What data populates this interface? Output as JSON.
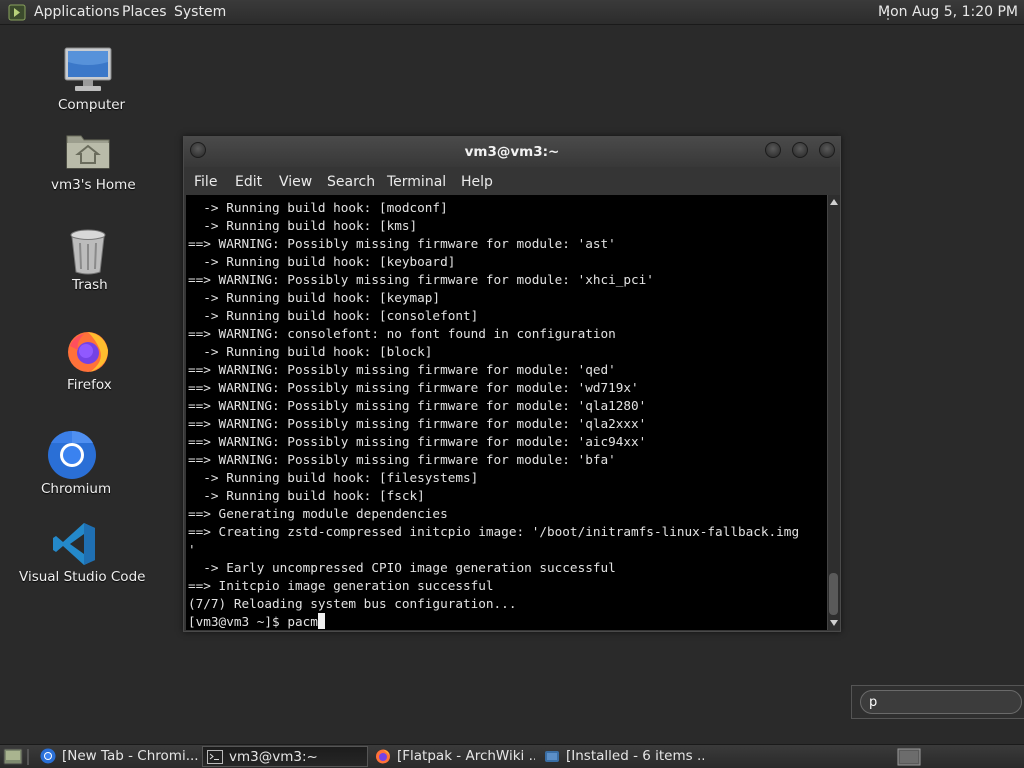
{
  "top_panel": {
    "menus": [
      "Applications",
      "Places",
      "System"
    ],
    "clock": "Mon Aug  5,  1:20 PM"
  },
  "desktop": {
    "icons": [
      {
        "label": "Computer",
        "icon": "computer-icon"
      },
      {
        "label": "vm3's Home",
        "icon": "home-folder-icon"
      },
      {
        "label": "Trash",
        "icon": "trash-icon"
      },
      {
        "label": "Firefox",
        "icon": "firefox-icon"
      },
      {
        "label": "Chromium",
        "icon": "chromium-icon"
      },
      {
        "label": "Visual Studio Code",
        "icon": "vscode-icon"
      }
    ]
  },
  "terminal": {
    "title": "vm3@vm3:~",
    "menu": [
      "File",
      "Edit",
      "View",
      "Search",
      "Terminal",
      "Help"
    ],
    "lines": [
      "  -> Running build hook: [modconf]",
      "  -> Running build hook: [kms]",
      "==> WARNING: Possibly missing firmware for module: 'ast'",
      "  -> Running build hook: [keyboard]",
      "==> WARNING: Possibly missing firmware for module: 'xhci_pci'",
      "  -> Running build hook: [keymap]",
      "  -> Running build hook: [consolefont]",
      "==> WARNING: consolefont: no font found in configuration",
      "  -> Running build hook: [block]",
      "==> WARNING: Possibly missing firmware for module: 'qed'",
      "==> WARNING: Possibly missing firmware for module: 'wd719x'",
      "==> WARNING: Possibly missing firmware for module: 'qla1280'",
      "==> WARNING: Possibly missing firmware for module: 'qla2xxx'",
      "==> WARNING: Possibly missing firmware for module: 'aic94xx'",
      "==> WARNING: Possibly missing firmware for module: 'bfa'",
      "  -> Running build hook: [filesystems]",
      "  -> Running build hook: [fsck]",
      "==> Generating module dependencies",
      "==> Creating zstd-compressed initcpio image: '/boot/initramfs-linux-fallback.img",
      "'",
      "  -> Early uncompressed CPIO image generation successful",
      "==> Initcpio image generation successful",
      "(7/7) Reloading system bus configuration..."
    ],
    "prompt": "[vm3@vm3 ~]$ ",
    "command": "pacm"
  },
  "search": {
    "value": "p"
  },
  "taskbar": {
    "tasks": [
      {
        "label": "[New Tab - Chromi...",
        "icon": "chromium-icon",
        "active": false
      },
      {
        "label": "vm3@vm3:~",
        "icon": "terminal-icon",
        "active": true
      },
      {
        "label": "[Flatpak - ArchWiki ...",
        "icon": "firefox-icon",
        "active": false
      },
      {
        "label": "[Installed - 6 items ...",
        "icon": "software-center-icon",
        "active": false
      }
    ]
  },
  "colors": {
    "desktop_bg": "#2a2a2a",
    "terminal_bg": "#000000",
    "terminal_fg": "#e2e2e2",
    "panel_bg": "#333333"
  }
}
